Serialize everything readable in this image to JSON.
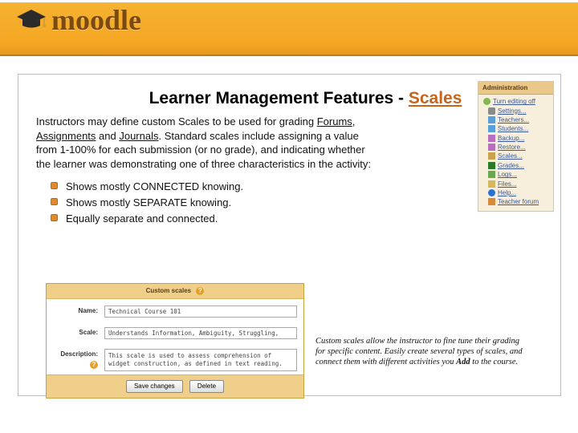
{
  "header": {
    "logo_text": "moodle"
  },
  "title": {
    "prefix": "Learner Management Features - ",
    "suffix": "Scales"
  },
  "intro": {
    "t1": "Instructors may define custom Scales to be used for grading ",
    "forums": "Forums",
    "sep1": ", ",
    "assignments": "Assignments",
    "sep2": " and ",
    "journals": "Journals",
    "t2": ". Standard scales include assigning a value from 1-100% for each submission (or no grade), and indicating whether the learner was demonstrating one of three characteristics in the activity:"
  },
  "knowing": {
    "items": [
      "Shows mostly CONNECTED knowing.",
      "Shows mostly SEPARATE knowing.",
      "Equally separate and connected."
    ]
  },
  "admin": {
    "title": "Administration",
    "links": [
      "Turn editing off",
      "Settings...",
      "Teachers...",
      "Students...",
      "Backup...",
      "Restore...",
      "Scales...",
      "Grades...",
      "Logs...",
      "Files...",
      "Help...",
      "Teacher forum"
    ]
  },
  "panel": {
    "title": "Custom scales",
    "labels": {
      "name": "Name:",
      "scale": "Scale:",
      "description": "Description:"
    },
    "name_value": "Technical Course 101",
    "scale_value": "Understands Information, Ambiguity, Struggling,",
    "desc_value": "This scale is used to assess comprehension of widget construction, as defined in text reading.",
    "buttons": {
      "save": "Save changes",
      "delete": "Delete"
    },
    "help_tip": "?"
  },
  "note": {
    "t1": "Custom scales allow the instructor to fine tune their grading for specific content. Easily create several types of scales, and connect them with different activities you ",
    "bold": "Add",
    "t2": " to the course."
  }
}
